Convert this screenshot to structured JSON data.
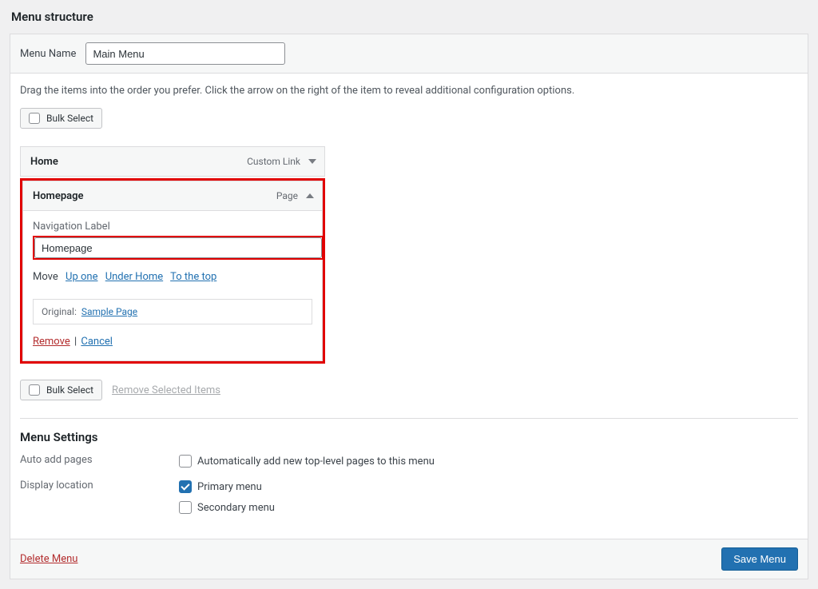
{
  "title": "Menu structure",
  "menu_name": {
    "label": "Menu Name",
    "value": "Main Menu"
  },
  "instructions": "Drag the items into the order you prefer. Click the arrow on the right of the item to reveal additional configuration options.",
  "bulk_select_label": "Bulk Select",
  "items": {
    "home": {
      "title": "Home",
      "type": "Custom Link"
    },
    "homepage": {
      "title": "Homepage",
      "type": "Page",
      "nav_label_field": "Navigation Label",
      "nav_label_value": "Homepage",
      "move_label": "Move",
      "move_links": {
        "up_one": "Up one",
        "under_home": "Under Home",
        "to_top": "To the top"
      },
      "original_label": "Original:",
      "original_link": "Sample Page",
      "remove": "Remove",
      "cancel": "Cancel"
    }
  },
  "remove_selected": "Remove Selected Items",
  "settings": {
    "heading": "Menu Settings",
    "auto_add": {
      "label": "Auto add pages",
      "option": "Automatically add new top-level pages to this menu"
    },
    "display_location": {
      "label": "Display location",
      "primary": "Primary menu",
      "secondary": "Secondary menu"
    }
  },
  "footer": {
    "delete": "Delete Menu",
    "save": "Save Menu"
  }
}
